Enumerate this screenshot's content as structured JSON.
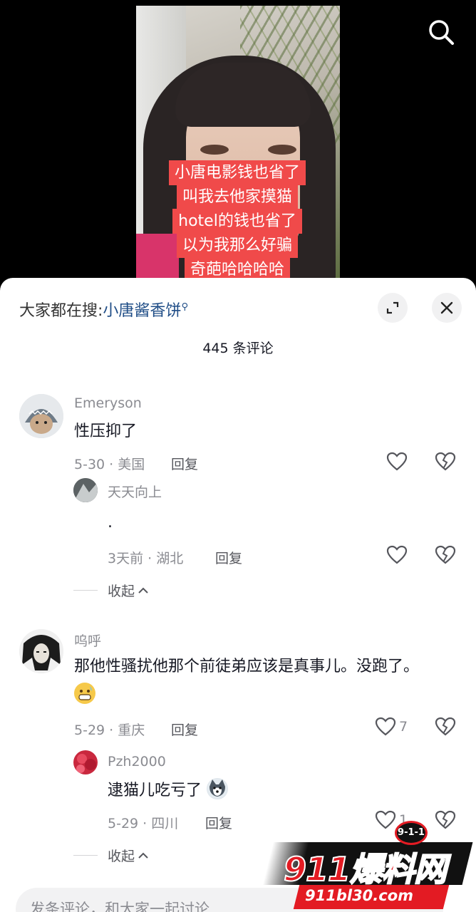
{
  "video": {
    "caption_lines": [
      "小唐电影钱也省了",
      "叫我去他家摸猫",
      "hotel的钱也省了",
      "以为我那么好骗",
      "奇葩哈哈哈哈"
    ]
  },
  "sheet": {
    "hot_search_prefix": "大家都在搜:",
    "hot_search_keyword": "小唐酱香饼",
    "comment_count": "445 条评论"
  },
  "comments": [
    {
      "name": "Emeryson",
      "text": "性压抑了",
      "meta": "5-30 · 美国",
      "reply_label": "回复",
      "like_count": "",
      "replies": [
        {
          "name": "天天向上",
          "text": ".",
          "meta": "3天前 · 湖北",
          "reply_label": "回复",
          "like_count": ""
        }
      ],
      "collapse_label": "收起"
    },
    {
      "name": "呜呼",
      "text": "那他性骚扰他那个前徒弟应该是真事儿。没跑了。",
      "meta": "5-29 · 重庆",
      "reply_label": "回复",
      "like_count": "7",
      "replies": [
        {
          "name": "Pzh2000",
          "text": "逮猫儿吃亏了",
          "meta": "5-29 · 四川",
          "reply_label": "回复",
          "like_count": "1"
        }
      ],
      "collapse_label": "收起"
    }
  ],
  "input": {
    "placeholder": "发条评论，和大家一起讨论"
  },
  "watermark": {
    "badge": "9-1-1",
    "title": "911爆料网",
    "url": "911bl30.com"
  },
  "colors": {
    "caption_bg": "#f04a4a",
    "link_blue": "#1e4c86",
    "watermark_red": "#e31b23"
  }
}
